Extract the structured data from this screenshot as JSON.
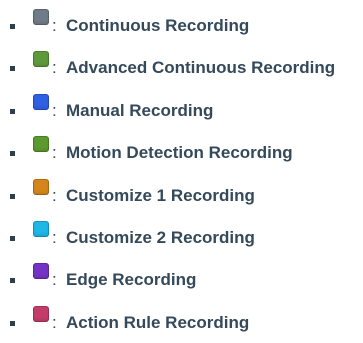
{
  "legend": {
    "items": [
      {
        "label": "Continuous Recording",
        "color": "#6f7b86",
        "icon": "continuous-recording-swatch-icon"
      },
      {
        "label": "Advanced Continuous Recording",
        "color": "#5e9a3c",
        "icon": "advanced-continuous-recording-swatch-icon"
      },
      {
        "label": "Manual Recording",
        "color": "#2f5fe3",
        "icon": "manual-recording-swatch-icon"
      },
      {
        "label": "Motion Detection Recording",
        "color": "#5c9a2f",
        "icon": "motion-detection-recording-swatch-icon"
      },
      {
        "label": "Customize 1 Recording",
        "color": "#d4861c",
        "icon": "customize-1-recording-swatch-icon"
      },
      {
        "label": "Customize 2 Recording",
        "color": "#1fb6e8",
        "icon": "customize-2-recording-swatch-icon"
      },
      {
        "label": "Edge Recording",
        "color": "#7433c4",
        "icon": "edge-recording-swatch-icon"
      },
      {
        "label": "Action Rule Recording",
        "color": "#c43d6a",
        "icon": "action-rule-recording-swatch-icon"
      }
    ],
    "separator": ":"
  }
}
